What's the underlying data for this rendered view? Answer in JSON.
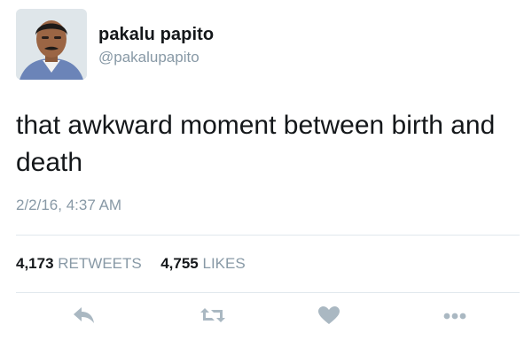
{
  "tweet": {
    "display_name": "pakalu papito",
    "handle": "@pakalupapito",
    "text": "that awkward moment between birth and death",
    "timestamp": "2/2/16, 4:37 AM",
    "stats": {
      "retweets_count": "4,173",
      "retweets_label": "RETWEETS",
      "likes_count": "4,755",
      "likes_label": "LIKES"
    }
  },
  "actions": {
    "icons": [
      "reply-icon",
      "retweet-icon",
      "like-icon",
      "more-icon"
    ]
  },
  "colors": {
    "text": "#14171a",
    "secondary": "#8899a6",
    "divider": "#e1e8ed",
    "icon": "#aab8c2"
  }
}
